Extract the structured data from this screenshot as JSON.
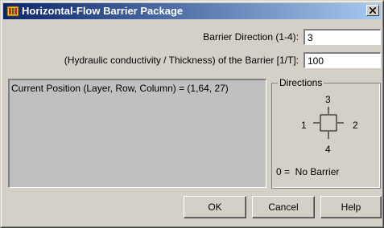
{
  "window": {
    "title": "Horizontal-Flow Barrier Package",
    "icon": "modflow-app-icon",
    "close_icon": "close-icon"
  },
  "form": {
    "direction_label": "Barrier Direction (1-4):",
    "direction_value": "3",
    "conductivity_label": "(Hydraulic conductivity / Thickness) of the Barrier [1/T]:",
    "conductivity_value": "100"
  },
  "position": {
    "text": "Current Position (Layer, Row, Column) = (1,64, 27)"
  },
  "directions": {
    "legend": "Directions",
    "n3": "3",
    "n1": "1",
    "n2": "2",
    "n4": "4",
    "note": "0 =  No Barrier"
  },
  "buttons": {
    "ok": "OK",
    "cancel": "Cancel",
    "help": "Help"
  },
  "colors": {
    "title_start": "#0a246a",
    "title_end": "#a6caf0",
    "face": "#d4d0c8",
    "position_bg": "#c0c0c0"
  }
}
